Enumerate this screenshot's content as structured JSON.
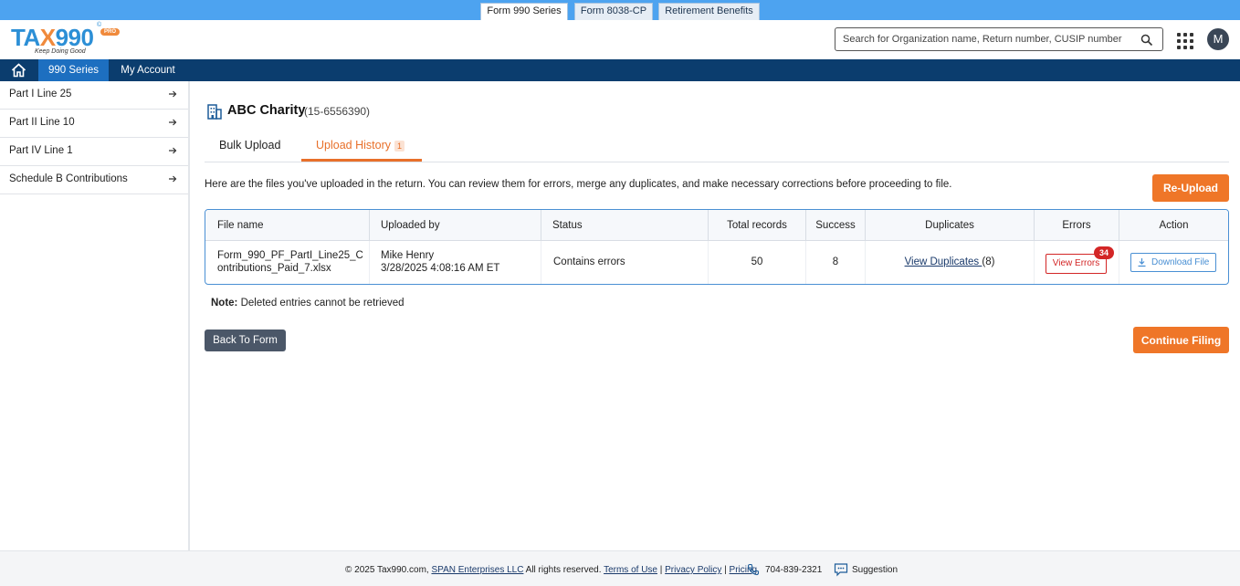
{
  "top_tabs": [
    {
      "label": "Form 990 Series",
      "active": true
    },
    {
      "label": "Form 8038-CP",
      "active": false
    },
    {
      "label": "Retirement Benefits",
      "active": false
    }
  ],
  "logo": {
    "text_a": "TA",
    "text_x": "X",
    "text_b": "990",
    "reg": "©",
    "badge": "PRO",
    "tagline": "Keep Doing Good"
  },
  "search": {
    "placeholder": "Search for Organization name, Return number, CUSIP number"
  },
  "avatar": {
    "initial": "M"
  },
  "nav": {
    "items": [
      "990 Series",
      "My Account"
    ]
  },
  "sidebar": {
    "items": [
      "Part I Line 25",
      "Part II Line 10",
      "Part IV Line 1",
      "Schedule B Contributions"
    ]
  },
  "org": {
    "name": "ABC Charity",
    "ein": "(15-6556390)"
  },
  "tabs": {
    "bulk_upload": "Bulk Upload",
    "upload_history": "Upload History",
    "upload_history_count": "1"
  },
  "intro": "Here are the files you've uploaded in the return. You can review them for errors, merge any duplicates, and make necessary corrections before proceeding to file.",
  "buttons": {
    "reupload": "Re-Upload",
    "back_to_form": "Back To Form",
    "continue_filing": "Continue Filing"
  },
  "table": {
    "headers": [
      "File name",
      "Uploaded by",
      "Status",
      "Total records",
      "Success",
      "Duplicates",
      "Errors",
      "Action"
    ],
    "rows": [
      {
        "file_name_1": "Form_990_PF_PartI_Line25_C",
        "file_name_2": "ontributions_Paid_7.xlsx",
        "uploaded_by": "Mike Henry",
        "uploaded_at": "3/28/2025 4:08:16 AM ET",
        "status": "Contains errors",
        "total_records": "50",
        "success": "8",
        "duplicates_link": "View Duplicates ",
        "duplicates_count": "(8)",
        "errors_button": "View Errors",
        "errors_count": "34",
        "action": "Download File"
      }
    ]
  },
  "note": {
    "label": "Note:",
    "text": " Deleted entries cannot be retrieved"
  },
  "footer": {
    "copyright": "© 2025 Tax990.com, ",
    "company": "SPAN Enterprises LLC",
    "rights": " All rights reserved. ",
    "terms": "Terms of Use",
    "sep1": " | ",
    "privacy": "Privacy Policy",
    "sep2": " | ",
    "pricing": "Pricing",
    "phone": "704-839-2321",
    "suggestion": "Suggestion"
  }
}
